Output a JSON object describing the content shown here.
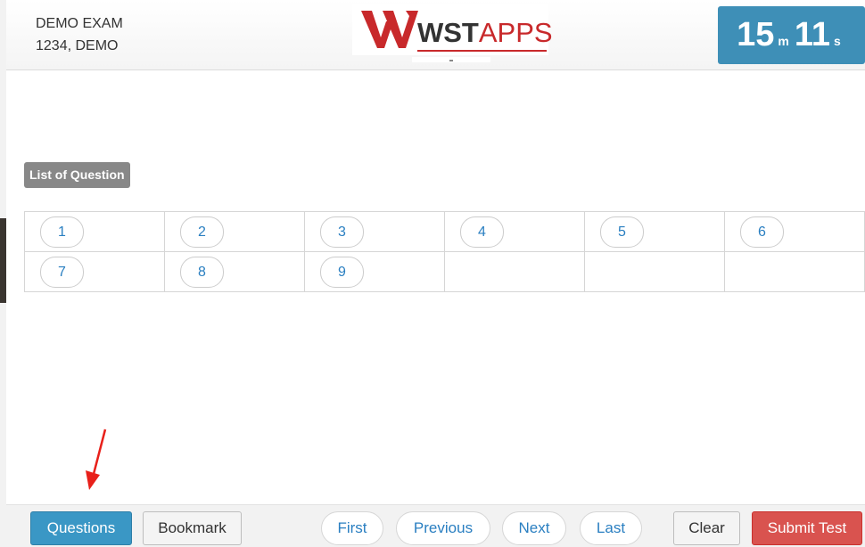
{
  "header": {
    "exam_title": "DEMO EXAM",
    "candidate": "1234, DEMO",
    "logo_icon": "wstapps-logo",
    "logo_wst": "WST",
    "logo_apps": "APPS",
    "timer": {
      "minutes": "15",
      "minutes_unit": "m",
      "seconds": "11",
      "seconds_unit": "s"
    }
  },
  "question_list": {
    "label": "List of Question",
    "rows": [
      [
        "1",
        "2",
        "3",
        "4",
        "5",
        "6"
      ],
      [
        "7",
        "8",
        "9",
        "",
        "",
        ""
      ]
    ]
  },
  "footer": {
    "questions": "Questions",
    "bookmark": "Bookmark",
    "first": "First",
    "previous": "Previous",
    "next": "Next",
    "last": "Last",
    "clear": "Clear",
    "submit": "Submit Test"
  },
  "annotation": {
    "arrow_icon": "red-arrow-icon",
    "arrow_color": "#e8201a"
  },
  "colors": {
    "timer_bg": "#3e8fb7",
    "primary_button": "#3a97c5",
    "submit_button": "#d9534f",
    "link_blue": "#2a7fc1",
    "brand_red": "#c8292b"
  }
}
